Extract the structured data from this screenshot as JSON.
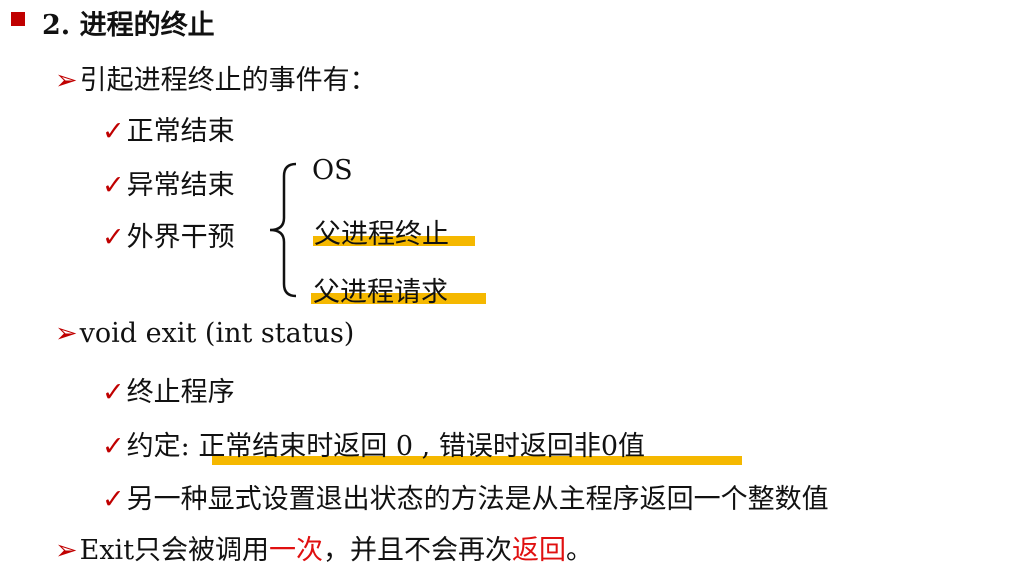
{
  "title": "2. 进程的终止",
  "marker": "➢",
  "check": "✓",
  "bullet1": "引起进程终止的事件有：",
  "events": [
    "正常结束",
    "异常结束",
    "外界干预"
  ],
  "interventions": [
    "OS",
    "父进程终止",
    "父进程请求"
  ],
  "bullet2": "void exit (int status)",
  "exit_items": {
    "item1": "终止程序",
    "item2_prefix": "约定: ",
    "item2_body": "正常结束时返回 0 , 错误时返回非0值",
    "item3": "另一种显式设置退出状态的方法是从主程序返回一个整数值"
  },
  "bullet3": {
    "part1": "Exit只会被调用",
    "red1": "一次",
    "part2": "，并且不会再次",
    "red2": "返回",
    "part3": "。"
  },
  "colors": {
    "accent": "#c00000",
    "highlight": "#f5b800",
    "emphasis": "#e01010"
  }
}
